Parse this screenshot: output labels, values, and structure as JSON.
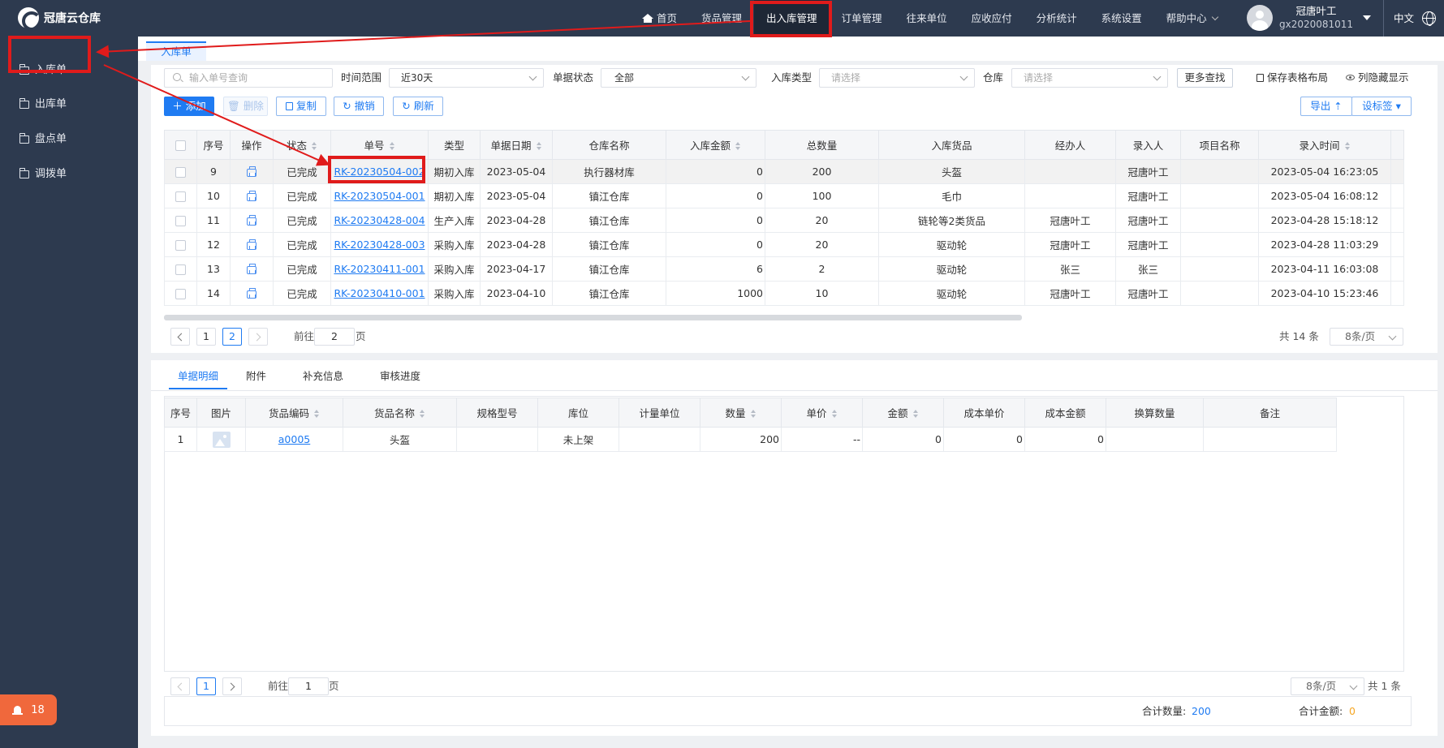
{
  "app": {
    "title": "冠唐云仓库"
  },
  "nav": {
    "home": "首页",
    "items": [
      "货品管理",
      "出入库管理",
      "订单管理",
      "往来单位",
      "应收应付",
      "分析统计",
      "系统设置"
    ],
    "help": "帮助中心"
  },
  "user": {
    "name": "冠唐叶工",
    "id": "gx2020081011"
  },
  "lang": "中文",
  "sidebar": {
    "items": [
      {
        "label": "入库单"
      },
      {
        "label": "出库单"
      },
      {
        "label": "盘点单"
      },
      {
        "label": "调拨单"
      }
    ],
    "badge_count": "18"
  },
  "tab": {
    "label": "入库单"
  },
  "filters": {
    "search_placeholder": "输入单号查询",
    "time_label": "时间范围",
    "time_value": "近30天",
    "status_label": "单据状态",
    "status_value": "全部",
    "type_label": "入库类型",
    "type_placeholder": "请选择",
    "warehouse_label": "仓库",
    "warehouse_placeholder": "请选择",
    "more_search": "更多查找",
    "save_layout": "保存表格布局",
    "column_hide": "列隐藏显示"
  },
  "toolbar": {
    "add": "添加",
    "delete": "删除",
    "copy": "复制",
    "revoke": "撤销",
    "refresh": "刷新",
    "export": "导出",
    "set_label": "设标签"
  },
  "main_table": {
    "headers": [
      "序号",
      "操作",
      "状态",
      "单号",
      "类型",
      "单据日期",
      "仓库名称",
      "入库金额",
      "总数量",
      "入库货品",
      "经办人",
      "录入人",
      "项目名称",
      "录入时间"
    ],
    "rows": [
      {
        "seq": "9",
        "status": "已完成",
        "no": "RK-20230504-002",
        "type": "期初入库",
        "date": "2023-05-04",
        "warehouse": "执行器材库",
        "amount": "0",
        "qty": "200",
        "goods": "头盔",
        "handler": "",
        "creator": "冠唐叶工",
        "project": "",
        "time": "2023-05-04 16:23:05"
      },
      {
        "seq": "10",
        "status": "已完成",
        "no": "RK-20230504-001",
        "type": "期初入库",
        "date": "2023-05-04",
        "warehouse": "镇江仓库",
        "amount": "0",
        "qty": "100",
        "goods": "毛巾",
        "handler": "",
        "creator": "冠唐叶工",
        "project": "",
        "time": "2023-05-04 16:08:12"
      },
      {
        "seq": "11",
        "status": "已完成",
        "no": "RK-20230428-004",
        "type": "生产入库",
        "date": "2023-04-28",
        "warehouse": "镇江仓库",
        "amount": "0",
        "qty": "20",
        "goods": "链轮等2类货品",
        "handler": "冠唐叶工",
        "creator": "冠唐叶工",
        "project": "",
        "time": "2023-04-28 15:18:12"
      },
      {
        "seq": "12",
        "status": "已完成",
        "no": "RK-20230428-003",
        "type": "采购入库",
        "date": "2023-04-28",
        "warehouse": "镇江仓库",
        "amount": "0",
        "qty": "20",
        "goods": "驱动轮",
        "handler": "冠唐叶工",
        "creator": "冠唐叶工",
        "project": "",
        "time": "2023-04-28 11:03:29"
      },
      {
        "seq": "13",
        "status": "已完成",
        "no": "RK-20230411-001",
        "type": "采购入库",
        "date": "2023-04-17",
        "warehouse": "镇江仓库",
        "amount": "6",
        "qty": "2",
        "goods": "驱动轮",
        "handler": "张三",
        "creator": "张三",
        "project": "",
        "time": "2023-04-11 16:03:08"
      },
      {
        "seq": "14",
        "status": "已完成",
        "no": "RK-20230410-001",
        "type": "采购入库",
        "date": "2023-04-10",
        "warehouse": "镇江仓库",
        "amount": "1000",
        "qty": "10",
        "goods": "驱动轮",
        "handler": "冠唐叶工",
        "creator": "冠唐叶工",
        "project": "",
        "time": "2023-04-10 15:23:46"
      }
    ]
  },
  "main_pagination": {
    "pages": [
      "1",
      "2"
    ],
    "current": "2",
    "goto_prefix": "前往",
    "goto_value": "2",
    "goto_suffix": "页",
    "total": "共 14 条",
    "page_size": "8条/页"
  },
  "detail_tabs": [
    "单据明细",
    "附件",
    "补充信息",
    "审核进度"
  ],
  "detail_table": {
    "headers": [
      "序号",
      "图片",
      "货品编码",
      "货品名称",
      "规格型号",
      "库位",
      "计量单位",
      "数量",
      "单价",
      "金额",
      "成本单价",
      "成本金额",
      "换算数量",
      "备注"
    ],
    "rows": [
      {
        "seq": "1",
        "code": "a0005",
        "name": "头盔",
        "spec": "",
        "location": "未上架",
        "unit": "",
        "qty": "200",
        "price": "--",
        "amount": "0",
        "cost_price": "0",
        "cost_amount": "0",
        "conv_qty": "",
        "remark": ""
      }
    ]
  },
  "detail_pagination": {
    "current": "1",
    "goto_prefix": "前往",
    "goto_value": "1",
    "goto_suffix": "页",
    "page_size": "8条/页",
    "total": "共 1 条"
  },
  "summary": {
    "qty_label": "合计数量:",
    "qty_value": "200",
    "amount_label": "合计金额:",
    "amount_value": "0"
  },
  "colors": {
    "nav_bg": "#2d3a4f",
    "accent": "#1f7bf2",
    "annotation": "#e01b1b",
    "badge": "#f0683c"
  }
}
